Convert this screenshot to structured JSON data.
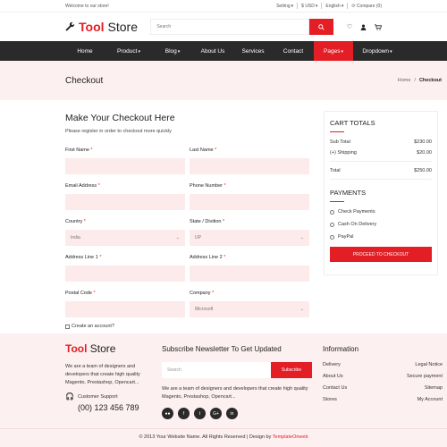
{
  "topbar": {
    "welcome": "Welcome to our store!",
    "setting": "Setting",
    "currency": "$ USD",
    "language": "English",
    "compare": "Compare (0)"
  },
  "header": {
    "logo_tool": "Tool",
    "logo_store": "Store",
    "search_placeholder": "Search"
  },
  "nav": {
    "items": [
      {
        "label": "Home",
        "dropdown": false
      },
      {
        "label": "Product",
        "dropdown": true
      },
      {
        "label": "Blog",
        "dropdown": true
      },
      {
        "label": "About Us",
        "dropdown": false
      },
      {
        "label": "Services",
        "dropdown": false
      },
      {
        "label": "Contact",
        "dropdown": false
      },
      {
        "label": "Pages",
        "dropdown": true
      },
      {
        "label": "Dropdown",
        "dropdown": true
      }
    ]
  },
  "page": {
    "title": "Checkout",
    "breadcrumb_home": "Home",
    "breadcrumb_sep": "/",
    "breadcrumb_current": "Checkout"
  },
  "form": {
    "heading": "Make Your Checkout Here",
    "subheading": "Please register in order to checkout more quickly",
    "first_name": "First Name",
    "last_name": "Last Name",
    "email": "Email Address",
    "phone": "Phone Number",
    "country": "Country",
    "country_value": "India",
    "state": "State / Divition",
    "state_value": "UP",
    "address1": "Address Line 1",
    "address2": "Address Line 2",
    "postal": "Postal Code",
    "company": "Company",
    "company_value": "Microsoft",
    "create_account": "Create an account?",
    "required_mark": "*"
  },
  "cart": {
    "heading": "CART TOTALS",
    "subtotal_label": "Sub Total",
    "subtotal_value": "$230.00",
    "shipping_label": "(+) Shipping",
    "shipping_value": "$20.00",
    "total_label": "Total",
    "total_value": "$250.00",
    "payments_heading": "PAYMENTS",
    "payment_options": [
      "Check Payments",
      "Cash On Delivery",
      "PayPal"
    ],
    "proceed_label": "PROCEED TO CHECKOUT"
  },
  "footer": {
    "logo_tool": "Tool",
    "logo_store": "Store",
    "about": "We are a team of designers and developers that create high quality Magento, Prestashop, Opencart...",
    "support_label": "Customer Support",
    "phone": "(00) 123 456 789",
    "newsletter_heading": "Subscribe Newsletter To Get Updated",
    "newsletter_placeholder": "Search",
    "subscribe_label": "Subscribe",
    "newsletter_text": "We are a team of designers and developers that create high quality Magento, Prestashop, Opencart...",
    "social": [
      "fb",
      "f",
      "tw",
      "G+",
      "in"
    ],
    "info_heading": "Information",
    "links": [
      "Delivery",
      "Legal Notice",
      "About Us",
      "Secure payment",
      "Contact Us",
      "Sitemap",
      "Stores",
      "My Account"
    ],
    "copyright": "© 2013 Your Website Name. All Rights Reserved | Design by",
    "copyright_brand": "TemplateOnweb"
  },
  "colors": {
    "accent": "#e31e24",
    "nav_bg": "#2a2a2a",
    "tint": "#fdf0f0"
  }
}
